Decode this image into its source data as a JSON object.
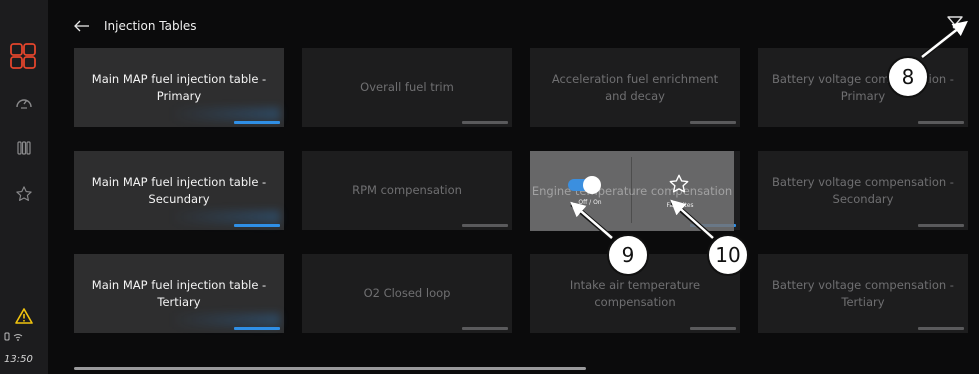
{
  "header": {
    "title": "Injection Tables"
  },
  "sidebar": {
    "clock": "13:50"
  },
  "tiles": [
    {
      "label": "Main MAP fuel injection table - Primary"
    },
    {
      "label": "Overall fuel trim"
    },
    {
      "label": "Acceleration fuel enrichment and decay"
    },
    {
      "label": "Battery voltage compensation - Primary"
    },
    {
      "label": "Main MAP fuel injection table - Secundary"
    },
    {
      "label": "RPM compensation"
    },
    {
      "label": "Engine temperature compensation"
    },
    {
      "label": "Battery voltage compensation - Secondary"
    },
    {
      "label": "Main MAP fuel injection table - Tertiary"
    },
    {
      "label": "O2 Closed loop"
    },
    {
      "label": "Intake air temperature compensation"
    },
    {
      "label": "Battery voltage compensation - Tertiary"
    }
  ],
  "popup": {
    "toggle_label": "Off / On",
    "favorite_label": "Favorites"
  },
  "callouts": {
    "c8": "8",
    "c9": "9",
    "c10": "10"
  },
  "colors": {
    "accent": "#2f8fe6",
    "alert": "#f1c40f",
    "active_icon": "#e2452c"
  }
}
